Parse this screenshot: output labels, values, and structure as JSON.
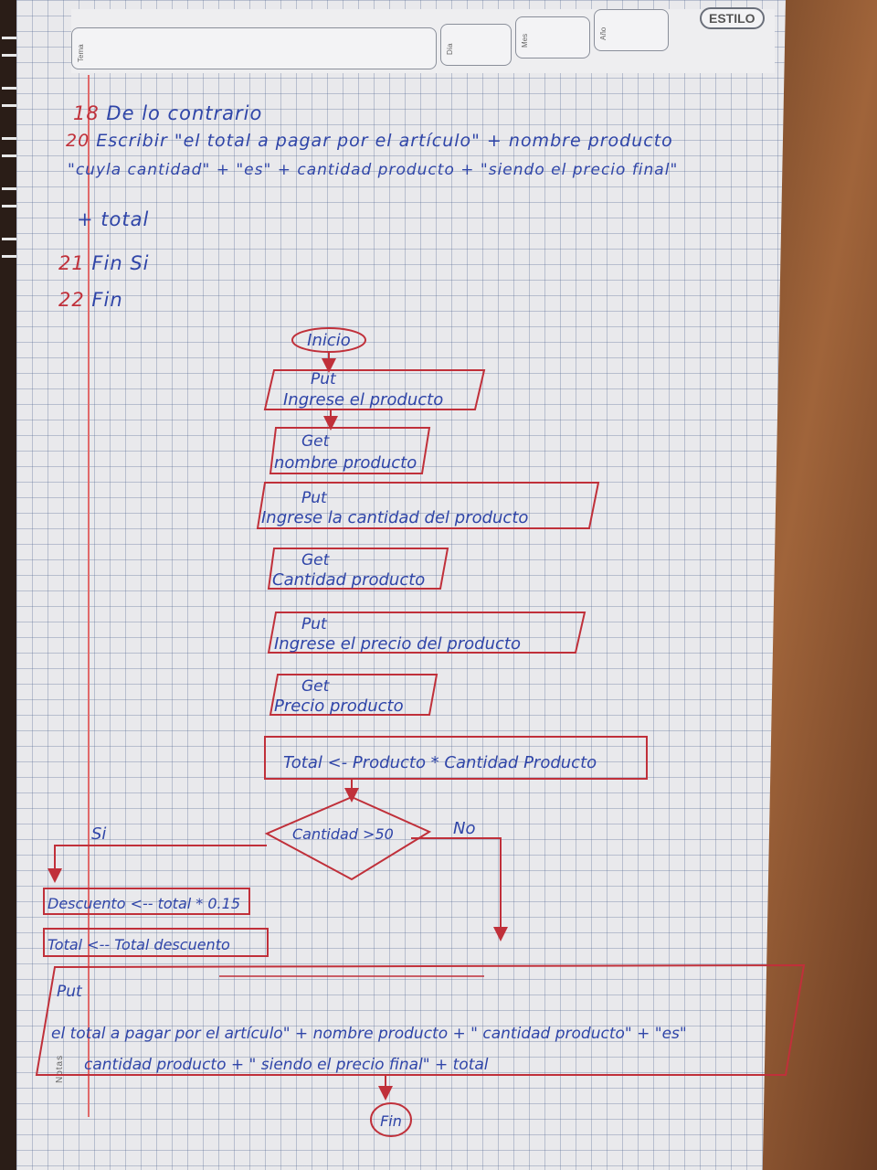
{
  "header": {
    "tema_label": "Tema",
    "dia_label": "Día",
    "mes_label": "Mes",
    "ano_label": "Año",
    "brand": "ESTILO",
    "notas_label": "Notas"
  },
  "pseudocode": {
    "lines": [
      {
        "num": "18",
        "text": "De lo contrario"
      },
      {
        "num": "20",
        "text": "Escribir \"el total a pagar por el artículo\" + nombre producto"
      },
      {
        "num": "",
        "text": "\"cuyla cantidad\" + \"es\" + cantidad producto + \"siendo el precio final\""
      },
      {
        "num": "",
        "text": "+ total"
      },
      {
        "num": "21",
        "text": "Fin Si"
      },
      {
        "num": "22",
        "text": "Fin"
      }
    ]
  },
  "flowchart": {
    "start": "Inicio",
    "steps": [
      {
        "type": "io",
        "op": "Put",
        "text": "Ingrese el producto"
      },
      {
        "type": "io",
        "op": "Get",
        "text": "nombre producto"
      },
      {
        "type": "io",
        "op": "Put",
        "text": "Ingrese la cantidad del producto"
      },
      {
        "type": "io",
        "op": "Get",
        "text": "Cantidad producto"
      },
      {
        "type": "io",
        "op": "Put",
        "text": "Ingrese el precio del producto"
      },
      {
        "type": "io",
        "op": "Get",
        "text": "Precio producto"
      },
      {
        "type": "process",
        "text": "Total <- Producto * Cantidad Producto"
      }
    ],
    "decision": {
      "text": "Cantidad >50",
      "yes": "Si",
      "no": "No"
    },
    "yes_branch": [
      "Descuento <-- total * 0.15",
      "Total <-- Total descuento"
    ],
    "output": {
      "op": "Put",
      "line1": "el total a pagar por el artículo\" + nombre producto + \" cantidad producto\" + \"es\"",
      "line2": "cantidad producto + \" siendo el precio final\" + total"
    },
    "end": "Fin"
  }
}
